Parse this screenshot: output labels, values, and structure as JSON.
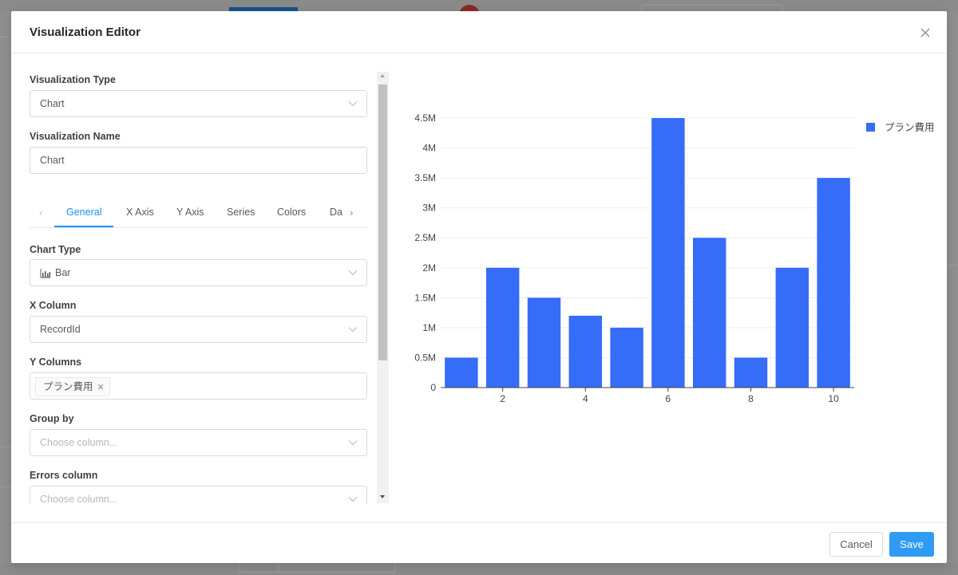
{
  "modal": {
    "title": "Visualization Editor"
  },
  "fields": {
    "visualization_type": {
      "label": "Visualization Type",
      "value": "Chart"
    },
    "visualization_name": {
      "label": "Visualization Name",
      "value": "Chart"
    },
    "chart_type": {
      "label": "Chart Type",
      "value": "Bar",
      "icon": "bar-chart-icon"
    },
    "x_column": {
      "label": "X Column",
      "value": "RecordId"
    },
    "y_columns": {
      "label": "Y Columns",
      "tags": [
        "プラン費用"
      ]
    },
    "group_by": {
      "label": "Group by",
      "placeholder": "Choose column..."
    },
    "errors_column": {
      "label": "Errors column",
      "placeholder": "Choose column..."
    }
  },
  "tabs": [
    {
      "label": "General",
      "active": true
    },
    {
      "label": "X Axis",
      "active": false
    },
    {
      "label": "Y Axis",
      "active": false
    },
    {
      "label": "Series",
      "active": false
    },
    {
      "label": "Colors",
      "active": false
    },
    {
      "label": "Da",
      "active": false
    }
  ],
  "footer": {
    "cancel_label": "Cancel",
    "save_label": "Save"
  },
  "colors": {
    "primary": "#1890ff",
    "save_button": "#2f9bf4",
    "bar": "#356cf8"
  },
  "chart_data": {
    "type": "bar",
    "x": [
      1,
      2,
      3,
      4,
      5,
      6,
      7,
      8,
      9,
      10
    ],
    "series": [
      {
        "name": "プラン費用",
        "values": [
          500000,
          2000000,
          1500000,
          1200000,
          1000000,
          4500000,
          2500000,
          500000,
          2000000,
          3500000
        ]
      }
    ],
    "x_ticks": [
      "2",
      "4",
      "6",
      "8",
      "10"
    ],
    "y_ticks": [
      "0",
      "0.5M",
      "1M",
      "1.5M",
      "2M",
      "2.5M",
      "3M",
      "3.5M",
      "4M",
      "4.5M"
    ],
    "ylim": [
      0,
      4500000
    ],
    "legend_position": "top-right",
    "grid": true
  }
}
